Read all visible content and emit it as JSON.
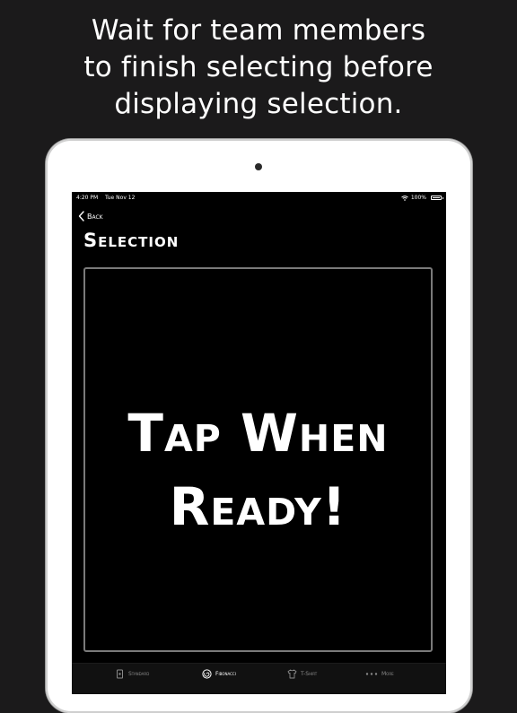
{
  "headline": {
    "lines": [
      "Wait for team members",
      "to finish selecting before",
      "displaying selection."
    ]
  },
  "statusbar": {
    "time": "4:20 PM",
    "date": "Tue Nov 12",
    "battery": "100%",
    "icons": [
      "wifi-icon",
      "battery-icon"
    ]
  },
  "nav": {
    "back_label": "Back",
    "back_icon": "chevron-left-icon"
  },
  "page": {
    "title": "Selection"
  },
  "card": {
    "message_lines": [
      "Tap When",
      "Ready!"
    ]
  },
  "tabbar": {
    "active_tab": "Fibonacci",
    "tabs": [
      {
        "label": "Standard",
        "icon": "card-deck-icon"
      },
      {
        "label": "Fibonacci",
        "icon": "fibonacci-spiral-icon"
      },
      {
        "label": "T-Shirt",
        "icon": "t-shirt-icon"
      },
      {
        "label": "More",
        "icon": "more-dots-icon"
      }
    ]
  },
  "colors": {
    "background": "#1b1a1b",
    "screen": "#000000",
    "text": "#ffffff",
    "inactive_tab": "#8a8a8a"
  }
}
